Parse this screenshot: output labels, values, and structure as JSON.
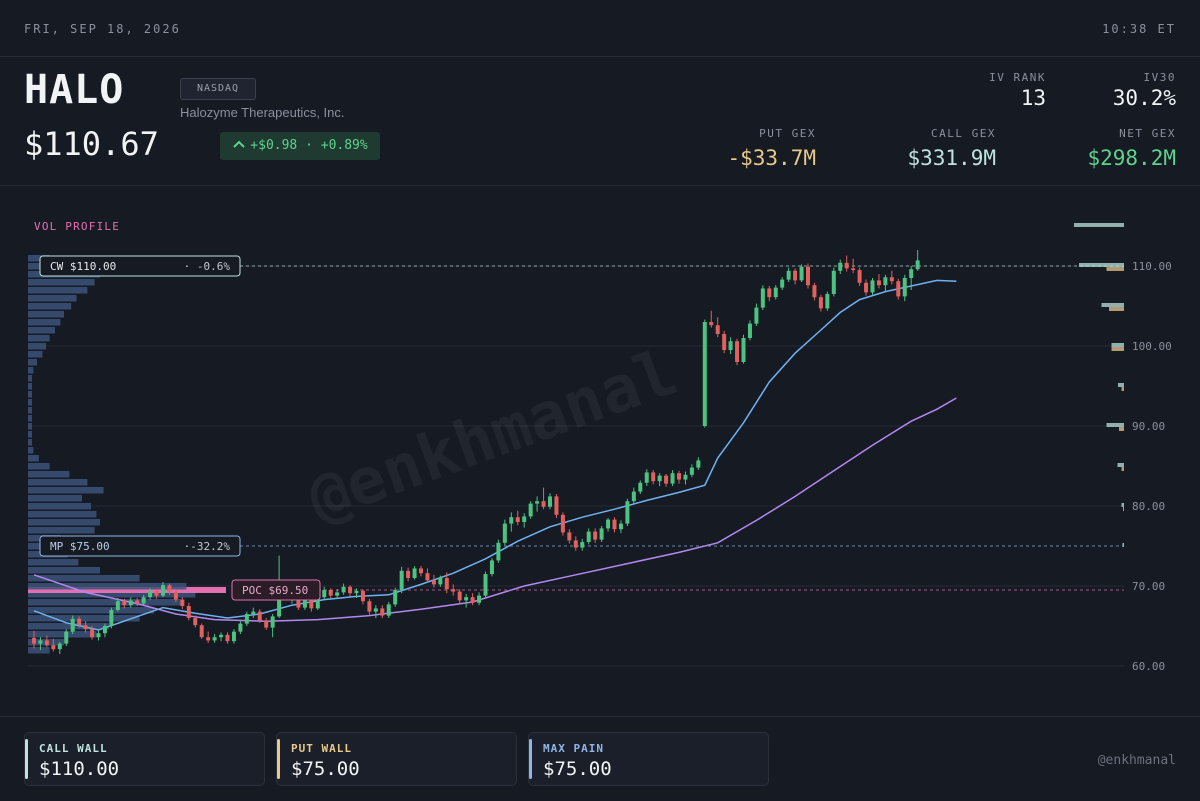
{
  "topbar": {
    "date": "FRI, SEP 18, 2026",
    "time": "10:38 ET"
  },
  "header": {
    "ticker": "HALO",
    "price": "$110.67",
    "exchange": "NASDAQ",
    "company": "Halozyme Therapeutics, Inc.",
    "change": "+$0.98 · +0.89%",
    "change_icon": "arrow-up-icon",
    "iv_rank": {
      "label": "IV RANK",
      "value": "13"
    },
    "iv30": {
      "label": "IV30",
      "value": "30.2%"
    },
    "put_gex": {
      "label": "PUT GEX",
      "value": "-$33.7M",
      "color": "#e8c98a"
    },
    "call_gex": {
      "label": "CALL GEX",
      "value": "$331.9M",
      "color": "#bfe3df"
    },
    "net_gex": {
      "label": "NET GEX",
      "value": "$298.2M",
      "color": "#5fd38d"
    }
  },
  "chart_data": {
    "type": "candlestick",
    "title": "",
    "volume_profile_label": "VOL PROFILE",
    "watermark": "@enkhmanal",
    "ylim": [
      56,
      116
    ],
    "yticks": [
      "60.00",
      "70.00",
      "80.00",
      "90.00",
      "100.00",
      "110.00"
    ],
    "ytick_values": [
      60,
      70,
      80,
      90,
      100,
      110
    ],
    "levels": [
      {
        "name": "CW",
        "label": "CW $110.00",
        "value": 110.0,
        "pct": "· -0.6%",
        "color": "#bfe3df"
      },
      {
        "name": "MP",
        "label": "MP $75.00",
        "value": 75.0,
        "pct": "·-32.2%",
        "color": "#8fb5e8"
      },
      {
        "name": "POC",
        "label": "POC $69.50",
        "value": 69.5,
        "color": "#e36fb0"
      }
    ],
    "candles_ohlc": [
      [
        63.5,
        64.4,
        62.2,
        62.8
      ],
      [
        62.8,
        63.6,
        62.0,
        63.2
      ],
      [
        63.2,
        63.8,
        62.4,
        62.6
      ],
      [
        62.6,
        63.4,
        61.8,
        62.1
      ],
      [
        62.1,
        63.0,
        61.5,
        62.8
      ],
      [
        62.8,
        64.6,
        62.5,
        64.3
      ],
      [
        64.3,
        66.3,
        64.0,
        65.9
      ],
      [
        65.9,
        66.2,
        64.8,
        65.1
      ],
      [
        65.1,
        65.6,
        64.2,
        64.6
      ],
      [
        64.6,
        65.0,
        63.3,
        63.6
      ],
      [
        63.6,
        64.4,
        63.2,
        64.1
      ],
      [
        64.1,
        65.3,
        63.6,
        65.0
      ],
      [
        65.0,
        67.3,
        64.7,
        67.0
      ],
      [
        67.0,
        68.5,
        66.8,
        68.1
      ],
      [
        68.1,
        68.4,
        67.2,
        67.6
      ],
      [
        67.6,
        68.6,
        67.3,
        68.2
      ],
      [
        68.2,
        68.5,
        67.5,
        67.8
      ],
      [
        67.8,
        68.9,
        67.6,
        68.6
      ],
      [
        68.6,
        69.7,
        68.3,
        69.4
      ],
      [
        69.4,
        69.6,
        68.4,
        68.8
      ],
      [
        68.8,
        70.5,
        68.6,
        70.1
      ],
      [
        70.1,
        70.3,
        68.9,
        69.3
      ],
      [
        69.3,
        69.5,
        68.0,
        68.3
      ],
      [
        68.3,
        68.6,
        67.1,
        67.5
      ],
      [
        67.5,
        67.9,
        65.7,
        66.0
      ],
      [
        66.0,
        66.3,
        64.8,
        65.1
      ],
      [
        65.1,
        65.3,
        63.4,
        63.6
      ],
      [
        63.6,
        64.3,
        62.9,
        63.2
      ],
      [
        63.2,
        64.0,
        62.9,
        63.6
      ],
      [
        63.6,
        64.2,
        63.1,
        63.9
      ],
      [
        63.9,
        64.2,
        62.8,
        63.1
      ],
      [
        63.1,
        64.6,
        62.8,
        64.3
      ],
      [
        64.3,
        65.6,
        64.0,
        65.3
      ],
      [
        65.3,
        66.8,
        65.0,
        66.5
      ],
      [
        66.5,
        67.3,
        66.0,
        66.8
      ],
      [
        66.8,
        67.1,
        65.4,
        65.7
      ],
      [
        65.7,
        66.0,
        64.5,
        64.8
      ],
      [
        64.8,
        66.5,
        63.6,
        66.2
      ],
      [
        66.2,
        73.8,
        66.0,
        69.5
      ],
      [
        69.5,
        69.8,
        68.2,
        68.6
      ],
      [
        68.6,
        69.2,
        67.8,
        69.0
      ],
      [
        69.0,
        69.3,
        67.0,
        67.3
      ],
      [
        67.3,
        68.6,
        67.0,
        68.3
      ],
      [
        68.3,
        68.5,
        66.8,
        67.2
      ],
      [
        67.2,
        68.8,
        67.0,
        68.6
      ],
      [
        68.6,
        69.9,
        68.3,
        69.5
      ],
      [
        69.5,
        69.7,
        68.5,
        68.8
      ],
      [
        68.8,
        69.6,
        68.4,
        69.2
      ],
      [
        69.2,
        70.3,
        68.9,
        69.9
      ],
      [
        69.9,
        70.1,
        68.7,
        69.1
      ],
      [
        69.1,
        69.7,
        68.5,
        69.4
      ],
      [
        69.4,
        69.6,
        67.7,
        68.1
      ],
      [
        68.1,
        68.4,
        66.4,
        66.8
      ],
      [
        66.8,
        67.6,
        66.0,
        67.2
      ],
      [
        67.2,
        67.6,
        66.0,
        66.3
      ],
      [
        66.3,
        68.0,
        66.0,
        67.7
      ],
      [
        67.7,
        69.8,
        67.4,
        69.5
      ],
      [
        69.5,
        72.4,
        69.1,
        71.9
      ],
      [
        71.9,
        72.3,
        70.6,
        71.0
      ],
      [
        71.0,
        72.5,
        70.8,
        72.2
      ],
      [
        72.2,
        72.5,
        71.2,
        71.6
      ],
      [
        71.6,
        72.2,
        70.4,
        70.7
      ],
      [
        70.7,
        71.4,
        69.8,
        70.2
      ],
      [
        70.2,
        71.3,
        69.9,
        71.0
      ],
      [
        71.0,
        71.7,
        69.1,
        69.6
      ],
      [
        69.6,
        70.2,
        68.8,
        69.3
      ],
      [
        69.3,
        69.6,
        67.8,
        68.2
      ],
      [
        68.2,
        69.0,
        67.3,
        68.6
      ],
      [
        68.6,
        69.1,
        67.6,
        67.9
      ],
      [
        67.9,
        69.2,
        67.6,
        68.8
      ],
      [
        68.8,
        71.8,
        68.6,
        71.5
      ],
      [
        71.5,
        73.5,
        71.2,
        73.2
      ],
      [
        73.2,
        75.8,
        72.9,
        75.4
      ],
      [
        75.4,
        78.3,
        75.1,
        77.8
      ],
      [
        77.8,
        79.2,
        76.8,
        78.6
      ],
      [
        78.6,
        79.4,
        77.6,
        78.0
      ],
      [
        78.0,
        79.1,
        77.3,
        78.7
      ],
      [
        78.7,
        80.6,
        78.4,
        80.3
      ],
      [
        80.3,
        81.2,
        79.3,
        80.6
      ],
      [
        80.6,
        82.3,
        79.6,
        79.9
      ],
      [
        79.9,
        81.6,
        79.6,
        81.2
      ],
      [
        81.2,
        81.5,
        78.5,
        78.9
      ],
      [
        78.9,
        79.2,
        76.3,
        76.7
      ],
      [
        76.7,
        77.1,
        75.3,
        75.7
      ],
      [
        75.7,
        76.2,
        74.4,
        74.8
      ],
      [
        74.8,
        75.9,
        74.4,
        75.5
      ],
      [
        75.5,
        77.2,
        75.2,
        76.8
      ],
      [
        76.8,
        77.2,
        75.4,
        75.8
      ],
      [
        75.8,
        77.5,
        75.5,
        77.2
      ],
      [
        77.2,
        78.5,
        76.8,
        78.3
      ],
      [
        78.3,
        78.6,
        76.7,
        77.1
      ],
      [
        77.1,
        78.2,
        76.6,
        77.8
      ],
      [
        77.8,
        80.9,
        77.5,
        80.6
      ],
      [
        80.6,
        82.3,
        80.3,
        81.8
      ],
      [
        81.8,
        83.2,
        81.5,
        82.9
      ],
      [
        82.9,
        84.6,
        82.5,
        84.2
      ],
      [
        84.2,
        84.5,
        82.7,
        83.1
      ],
      [
        83.1,
        84.1,
        82.5,
        83.8
      ],
      [
        83.8,
        84.0,
        82.4,
        82.8
      ],
      [
        82.8,
        84.5,
        82.5,
        84.1
      ],
      [
        84.1,
        84.4,
        82.8,
        83.3
      ],
      [
        83.3,
        84.3,
        82.7,
        83.9
      ],
      [
        83.9,
        85.2,
        83.6,
        84.8
      ],
      [
        84.8,
        86.1,
        84.5,
        85.7
      ],
      [
        90.0,
        103.3,
        89.8,
        103.0
      ],
      [
        103.0,
        104.4,
        102.3,
        102.6
      ],
      [
        102.6,
        103.6,
        101.1,
        101.5
      ],
      [
        101.5,
        101.9,
        99.1,
        99.5
      ],
      [
        99.5,
        101.1,
        99.0,
        100.6
      ],
      [
        100.6,
        100.9,
        97.6,
        98.0
      ],
      [
        98.0,
        101.4,
        97.8,
        101.0
      ],
      [
        101.0,
        103.2,
        100.7,
        102.8
      ],
      [
        102.8,
        105.3,
        102.5,
        104.8
      ],
      [
        104.8,
        107.6,
        104.5,
        107.2
      ],
      [
        107.2,
        107.5,
        105.6,
        106.1
      ],
      [
        106.1,
        107.6,
        105.8,
        107.3
      ],
      [
        107.3,
        108.6,
        107.0,
        108.3
      ],
      [
        108.3,
        109.8,
        108.0,
        109.4
      ],
      [
        109.4,
        109.7,
        107.7,
        108.2
      ],
      [
        108.2,
        110.2,
        108.0,
        109.9
      ],
      [
        109.9,
        110.3,
        107.2,
        107.6
      ],
      [
        107.6,
        107.9,
        105.7,
        106.1
      ],
      [
        106.1,
        106.4,
        104.3,
        104.7
      ],
      [
        104.7,
        106.8,
        104.4,
        106.5
      ],
      [
        106.5,
        109.8,
        106.2,
        109.4
      ],
      [
        109.4,
        110.8,
        109.0,
        110.4
      ],
      [
        110.4,
        111.3,
        109.3,
        109.7
      ],
      [
        109.7,
        110.9,
        109.1,
        109.5
      ],
      [
        109.5,
        109.8,
        107.5,
        107.9
      ],
      [
        107.9,
        108.3,
        106.3,
        106.7
      ],
      [
        106.7,
        108.5,
        106.4,
        108.2
      ],
      [
        108.2,
        109.0,
        107.2,
        107.6
      ],
      [
        107.6,
        108.9,
        106.8,
        108.6
      ],
      [
        108.6,
        109.4,
        107.7,
        108.1
      ],
      [
        108.1,
        108.4,
        105.8,
        106.2
      ],
      [
        106.2,
        108.9,
        105.6,
        108.5
      ],
      [
        108.5,
        110.0,
        107.0,
        109.6
      ],
      [
        109.6,
        112.0,
        109.4,
        110.7
      ]
    ],
    "ma_fast": [
      [
        0,
        66.9
      ],
      [
        5,
        65.4
      ],
      [
        10,
        64.5
      ],
      [
        15,
        65.9
      ],
      [
        20,
        67.3
      ],
      [
        25,
        66.6
      ],
      [
        30,
        66.0
      ],
      [
        35,
        66.5
      ],
      [
        40,
        67.6
      ],
      [
        45,
        68.3
      ],
      [
        50,
        68.7
      ],
      [
        55,
        68.9
      ],
      [
        60,
        70.2
      ],
      [
        65,
        71.6
      ],
      [
        70,
        73.4
      ],
      [
        75,
        75.6
      ],
      [
        80,
        77.4
      ],
      [
        85,
        78.6
      ],
      [
        90,
        79.6
      ],
      [
        95,
        80.7
      ],
      [
        100,
        81.7
      ],
      [
        104,
        82.6
      ],
      [
        106,
        86.0
      ],
      [
        110,
        90.4
      ],
      [
        114,
        95.5
      ],
      [
        118,
        99.1
      ],
      [
        122,
        102.0
      ],
      [
        125,
        104.2
      ],
      [
        128,
        105.8
      ],
      [
        132,
        106.8
      ],
      [
        136,
        107.5
      ],
      [
        140,
        108.2
      ],
      [
        143,
        108.1
      ]
    ],
    "ma_slow": [
      [
        0,
        71.4
      ],
      [
        8,
        69.2
      ],
      [
        16,
        67.8
      ],
      [
        22,
        66.5
      ],
      [
        28,
        65.8
      ],
      [
        36,
        65.6
      ],
      [
        44,
        65.8
      ],
      [
        52,
        66.3
      ],
      [
        60,
        67.1
      ],
      [
        68,
        68.0
      ],
      [
        76,
        70.0
      ],
      [
        84,
        71.4
      ],
      [
        92,
        72.8
      ],
      [
        100,
        74.2
      ],
      [
        106,
        75.4
      ],
      [
        112,
        78.2
      ],
      [
        118,
        81.2
      ],
      [
        124,
        84.4
      ],
      [
        130,
        87.6
      ],
      [
        136,
        90.6
      ],
      [
        140,
        92.1
      ],
      [
        143,
        93.5
      ]
    ],
    "volume_profile": [
      {
        "price": 62.0,
        "volume": 0.12
      },
      {
        "price": 63.0,
        "volume": 0.2
      },
      {
        "price": 64.0,
        "volume": 0.38
      },
      {
        "price": 65.0,
        "volume": 0.45
      },
      {
        "price": 66.0,
        "volume": 0.62
      },
      {
        "price": 67.0,
        "volume": 0.7
      },
      {
        "price": 68.0,
        "volume": 0.85
      },
      {
        "price": 69.0,
        "volume": 0.93
      },
      {
        "price": 69.5,
        "volume": 1.0
      },
      {
        "price": 70.0,
        "volume": 0.88
      },
      {
        "price": 71.0,
        "volume": 0.62
      },
      {
        "price": 72.0,
        "volume": 0.4
      },
      {
        "price": 73.0,
        "volume": 0.28
      },
      {
        "price": 74.0,
        "volume": 0.22
      },
      {
        "price": 75.0,
        "volume": 0.2
      },
      {
        "price": 76.0,
        "volume": 0.18
      },
      {
        "price": 77.0,
        "volume": 0.37
      },
      {
        "price": 78.0,
        "volume": 0.4
      },
      {
        "price": 79.0,
        "volume": 0.38
      },
      {
        "price": 80.0,
        "volume": 0.35
      },
      {
        "price": 81.0,
        "volume": 0.3
      },
      {
        "price": 82.0,
        "volume": 0.42
      },
      {
        "price": 83.0,
        "volume": 0.33
      },
      {
        "price": 84.0,
        "volume": 0.23
      },
      {
        "price": 85.0,
        "volume": 0.12
      },
      {
        "price": 86.0,
        "volume": 0.06
      },
      {
        "price": 87.0,
        "volume": 0.03
      },
      {
        "price": 88.0,
        "volume": 0.02
      },
      {
        "price": 89.0,
        "volume": 0.02
      },
      {
        "price": 90.0,
        "volume": 0.02
      },
      {
        "price": 91.0,
        "volume": 0.02
      },
      {
        "price": 92.0,
        "volume": 0.02
      },
      {
        "price": 93.0,
        "volume": 0.02
      },
      {
        "price": 94.0,
        "volume": 0.02
      },
      {
        "price": 95.0,
        "volume": 0.02
      },
      {
        "price": 96.0,
        "volume": 0.02
      },
      {
        "price": 97.0,
        "volume": 0.03
      },
      {
        "price": 98.0,
        "volume": 0.05
      },
      {
        "price": 99.0,
        "volume": 0.08
      },
      {
        "price": 100.0,
        "volume": 0.1
      },
      {
        "price": 101.0,
        "volume": 0.12
      },
      {
        "price": 102.0,
        "volume": 0.15
      },
      {
        "price": 103.0,
        "volume": 0.18
      },
      {
        "price": 104.0,
        "volume": 0.2
      },
      {
        "price": 105.0,
        "volume": 0.24
      },
      {
        "price": 106.0,
        "volume": 0.27
      },
      {
        "price": 107.0,
        "volume": 0.33
      },
      {
        "price": 108.0,
        "volume": 0.37
      },
      {
        "price": 109.0,
        "volume": 0.4
      },
      {
        "price": 110.0,
        "volume": 0.36
      },
      {
        "price": 111.0,
        "volume": 0.12
      }
    ],
    "gex_bars": [
      {
        "strike": 115,
        "call": 1.0
      },
      {
        "strike": 110,
        "call": 0.9,
        "put": 0.35
      },
      {
        "strike": 105,
        "call": 0.45,
        "put": 0.3
      },
      {
        "strike": 100,
        "call": 0.25,
        "put": 0.25
      },
      {
        "strike": 95,
        "call": 0.12,
        "put": 0.05
      },
      {
        "strike": 90,
        "call": 0.35,
        "put": 0.1
      },
      {
        "strike": 85,
        "call": 0.13,
        "put": 0.05
      },
      {
        "strike": 80,
        "call": 0.05,
        "put": 0.02
      },
      {
        "strike": 75,
        "call": 0.03
      }
    ],
    "colors": {
      "up": "#4cc381",
      "down": "#e0615e",
      "ma_fast": "#6fb2f2",
      "ma_slow": "#b488f0",
      "profile": "#3b5479",
      "poc": "#e36fb0",
      "gex_call": "#8fb0ad",
      "gex_put": "#b49a72",
      "grid": "#262b36"
    }
  },
  "footer": {
    "cards": [
      {
        "label": "CALL WALL",
        "value": "$110.00",
        "color": "#bfe3df"
      },
      {
        "label": "PUT WALL",
        "value": "$75.00",
        "color": "#e8c98a"
      },
      {
        "label": "MAX PAIN",
        "value": "$75.00",
        "color": "#8fb5e8"
      }
    ],
    "handle": "@enkhmanal"
  }
}
